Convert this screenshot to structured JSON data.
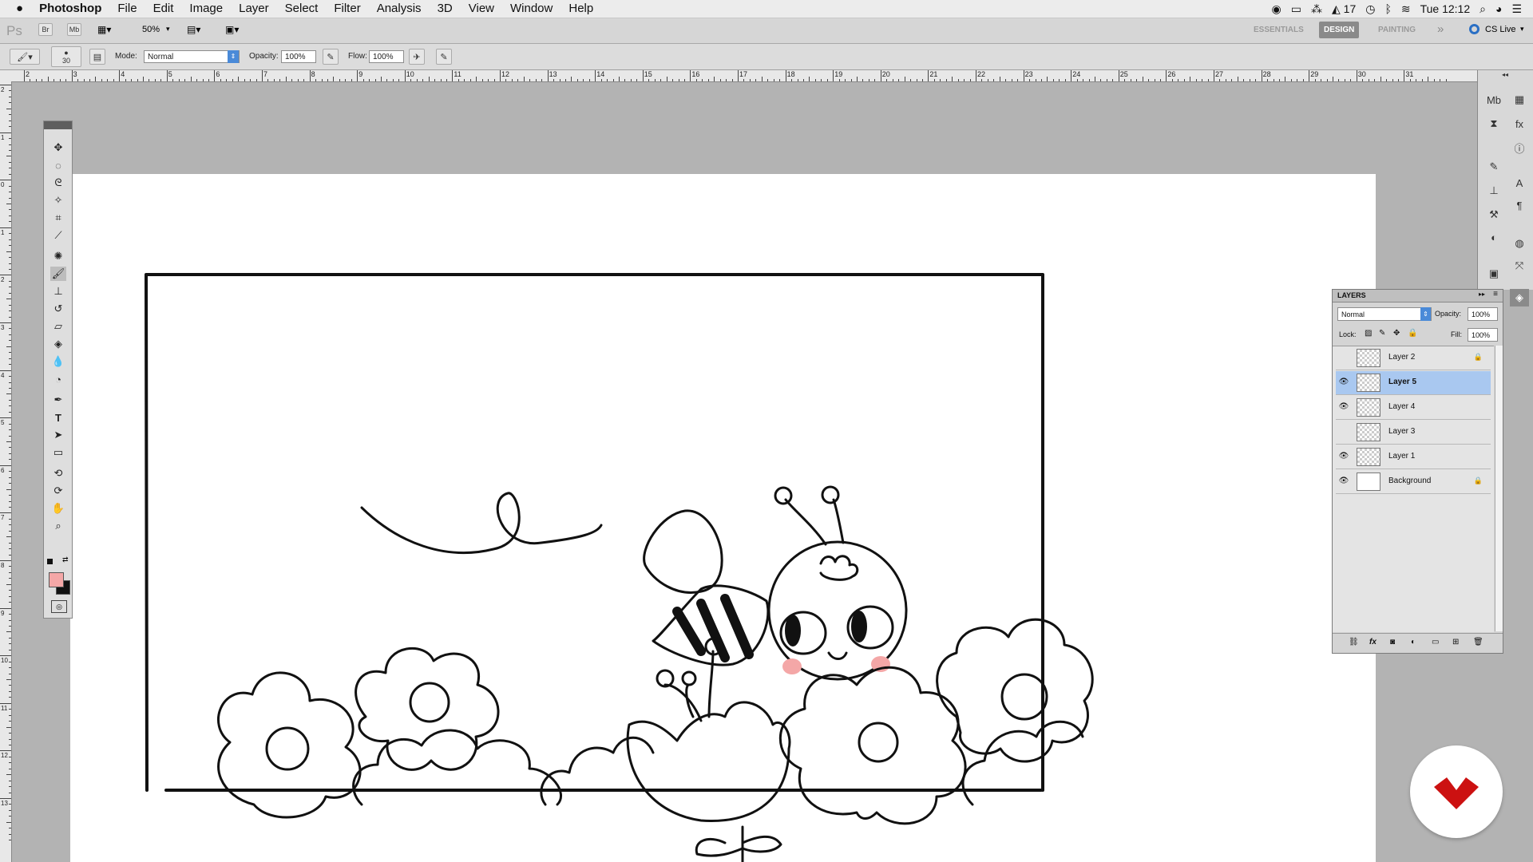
{
  "menubar": {
    "app": "Photoshop",
    "items": [
      "File",
      "Edit",
      "Image",
      "Layer",
      "Select",
      "Filter",
      "Analysis",
      "3D",
      "View",
      "Window",
      "Help"
    ],
    "status_count": "17",
    "clock": "Tue 12:12"
  },
  "appbar": {
    "logo": "Ps",
    "bridge": "Br",
    "minibridge": "Mb",
    "zoom": "50%",
    "workspaces": [
      "ESSENTIALS",
      "DESIGN",
      "PAINTING"
    ],
    "active_workspace": "DESIGN",
    "more": "»",
    "cslive": "CS Live"
  },
  "options": {
    "brush_size": "30",
    "mode_label": "Mode:",
    "mode_value": "Normal",
    "opacity_label": "Opacity:",
    "opacity_value": "100%",
    "flow_label": "Flow:",
    "flow_value": "100%"
  },
  "ruler_top": [
    "2",
    "3",
    "4",
    "5",
    "6",
    "7",
    "8",
    "9",
    "10",
    "11",
    "12",
    "13",
    "14",
    "15",
    "16",
    "17",
    "18",
    "19",
    "20",
    "21",
    "22",
    "23",
    "24",
    "25",
    "26",
    "27",
    "28",
    "29",
    "30",
    "31"
  ],
  "ruler_left": [
    "2",
    "1",
    "0",
    "1",
    "2",
    "3",
    "4",
    "5",
    "6",
    "7",
    "8",
    "9",
    "10",
    "11",
    "12",
    "13"
  ],
  "colors": {
    "foreground": "#f4a7a7",
    "background": "#111111",
    "selection": "#a9c8f0",
    "badge": "#cc1111"
  },
  "layers_panel": {
    "title": "LAYERS",
    "blend_mode": "Normal",
    "opacity_label": "Opacity:",
    "opacity_value": "100%",
    "lock_label": "Lock:",
    "fill_label": "Fill:",
    "fill_value": "100%",
    "layers": [
      {
        "name": "Layer 2",
        "visible": false,
        "locked": true,
        "selected": false
      },
      {
        "name": "Layer 5",
        "visible": true,
        "locked": false,
        "selected": true
      },
      {
        "name": "Layer 4",
        "visible": true,
        "locked": false,
        "selected": false
      },
      {
        "name": "Layer 3",
        "visible": false,
        "locked": false,
        "selected": false
      },
      {
        "name": "Layer 1",
        "visible": true,
        "locked": false,
        "selected": false
      },
      {
        "name": "Background",
        "visible": true,
        "locked": true,
        "selected": false
      }
    ]
  }
}
